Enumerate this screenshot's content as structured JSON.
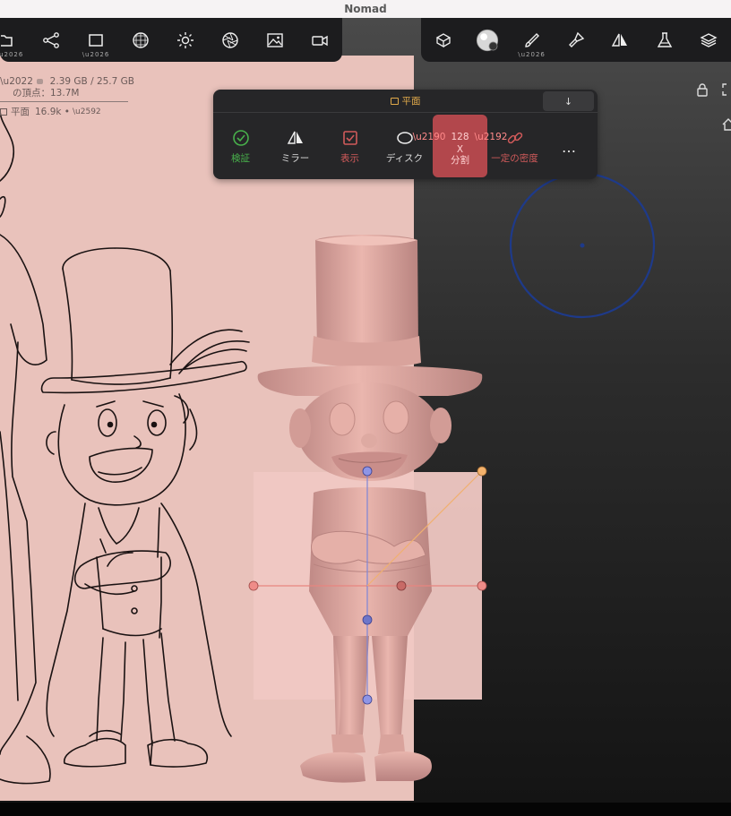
{
  "window": {
    "title": "Nomad"
  },
  "stats": {
    "memory": "2.39 GB / 25.7 GB",
    "vertices": "の頂点：13.7M",
    "object_name": "平面",
    "object_vertices": "16.9k •"
  },
  "toolbar_left": {
    "items": [
      "folder-icon",
      "scene-graph-icon",
      "topology-icon",
      "material-sphere-icon",
      "light-icon",
      "camera-aperture-icon",
      "background-image-icon",
      "video-camera-icon"
    ]
  },
  "toolbar_right": {
    "items": [
      "box-tool-icon",
      "matcap-sphere-icon",
      "brush-icon",
      "paint-brush-icon",
      "symmetry-icon",
      "flask-icon",
      "layers-icon"
    ]
  },
  "panel": {
    "title": "平面",
    "close_symbol": "↓",
    "buttons": {
      "validate": "検証",
      "mirror": "ミラー",
      "display": "表示",
      "disc": "ディスク",
      "division_value": "128",
      "division_axis": "X",
      "division_label": "分割",
      "density": "一定の密度",
      "more": "…"
    },
    "colors": {
      "accent": "#e0a94a",
      "green": "#48b04b",
      "red": "#d05a5a",
      "division_bg": "#b2474c"
    }
  },
  "viewport": {
    "reference_color": "#e9c2bb",
    "gizmo_x_color": "#e8857f",
    "gizmo_y_color": "#7f86d6",
    "gizmo_diag_color": "#f0b070",
    "brush_circle_color": "#1e3a8a"
  }
}
